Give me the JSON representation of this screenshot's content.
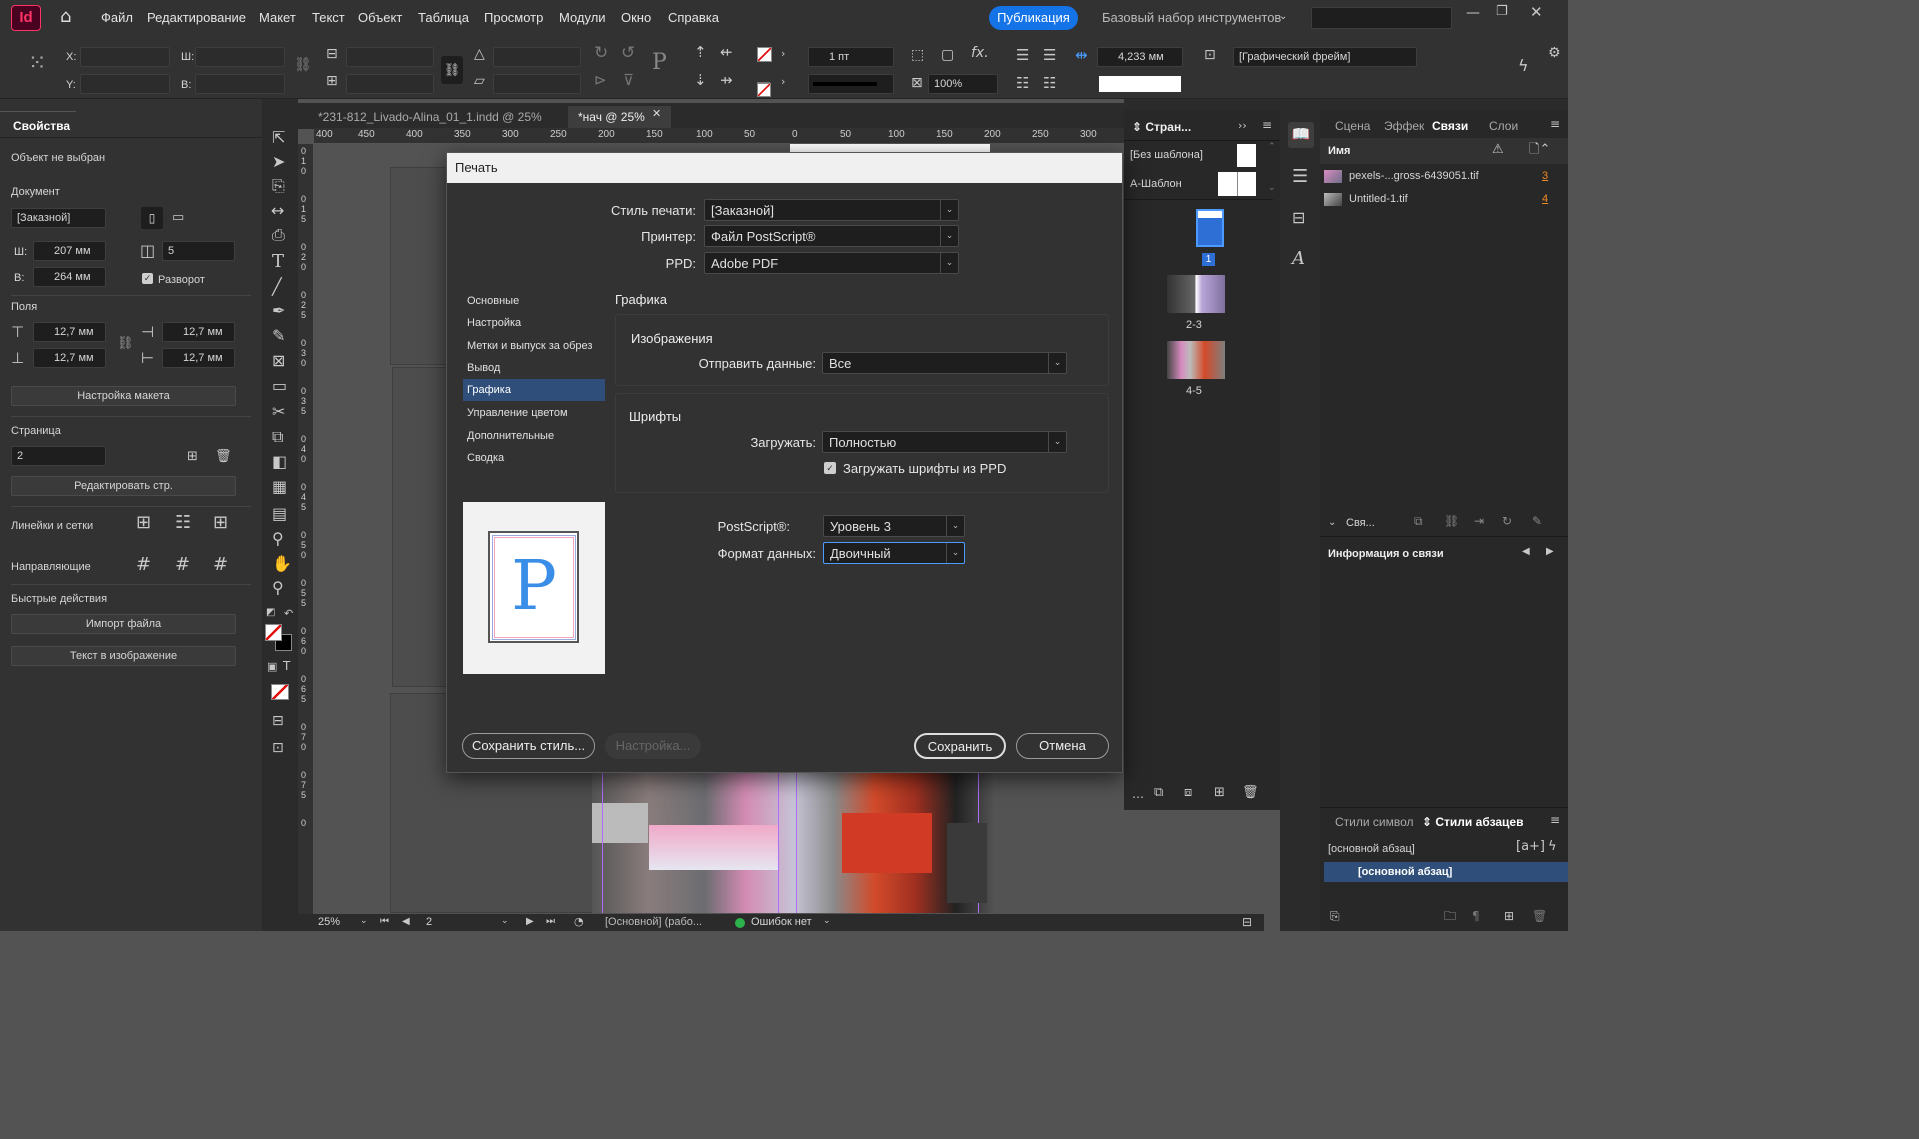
{
  "menubar": {
    "app_logo": "Id",
    "items": [
      "Файл",
      "Редактирование",
      "Макет",
      "Текст",
      "Объект",
      "Таблица",
      "Просмотр",
      "Модули",
      "Окно",
      "Справка"
    ],
    "publish": "Публикация",
    "workspace": "Базовый набор инструментов"
  },
  "control": {
    "x_label": "X:",
    "y_label": "Y:",
    "w_label": "Ш:",
    "h_label": "В:",
    "stroke_weight": "1 пт",
    "zoom_pct": "100%",
    "size_mm": "4,233 мм",
    "frame_style": "[Графический фрейм]"
  },
  "tabs": [
    "*231-812_Livado-Alina_01_1.indd @ 25%",
    "*нач @ 25%"
  ],
  "ruler": {
    "marks": [
      "400",
      "450",
      "400",
      "350",
      "300",
      "250",
      "200",
      "150",
      "100",
      "50",
      "0",
      "50",
      "100",
      "150",
      "200",
      "250",
      "300"
    ],
    "v_marks": [
      "0",
      "1",
      "0",
      "0",
      "1",
      "5",
      "0",
      "2",
      "0",
      "0",
      "2",
      "5",
      "0",
      "3",
      "0",
      "0",
      "3",
      "5",
      "0",
      "4",
      "0",
      "0",
      "4",
      "5",
      "0",
      "5",
      "0",
      "0",
      "5",
      "5",
      "0",
      "6",
      "0",
      "0",
      "6",
      "5",
      "0",
      "7",
      "0",
      "0",
      "7",
      "5",
      "0"
    ]
  },
  "properties": {
    "tab": "Свойства",
    "no_selection": "Объект не выбран",
    "document": "Документ",
    "preset": "[Заказной]",
    "width_label": "Ш:",
    "width": "207 мм",
    "height_label": "В:",
    "height": "264 мм",
    "pages": "5",
    "facing": "Разворот",
    "margins": "Поля",
    "m_top": "12,7 мм",
    "m_bottom": "12,7 мм",
    "m_left": "12,7 мм",
    "m_right": "12,7 мм",
    "layout_btn": "Настройка макета",
    "page": "Страница",
    "page_num": "2",
    "edit_page_btn": "Редактировать стр.",
    "rulers_grids": "Линейки и сетки",
    "guides": "Направляющие",
    "quick_actions": "Быстрые действия",
    "import_btn": "Импорт файла",
    "text_to_image_btn": "Текст в изображение"
  },
  "pages_panel": {
    "title": "Стран...",
    "none_master": "[Без шаблона]",
    "a_master": "А-Шаблон",
    "p1": "1",
    "p23": "2-3",
    "p45": "4-5"
  },
  "links_panel": {
    "tabs": [
      "Сцена",
      "Эффек",
      "Связи",
      "Слои"
    ],
    "name_col": "Имя",
    "items": [
      {
        "name": "pexels-...gross-6439051.tif",
        "page": "3"
      },
      {
        "name": "Untitled-1.tif",
        "page": "4"
      }
    ],
    "link_short": "Свя...",
    "link_info": "Информация о связи"
  },
  "styles_panel": {
    "tabs": [
      "Стили символ",
      "Стили абзацев"
    ],
    "current": "[основной абзац]",
    "item": "[основной абзац]"
  },
  "statusbar": {
    "zoom": "25%",
    "page": "2",
    "style": "[Основной] (рабо...",
    "errors": "Ошибок нет"
  },
  "print_dialog": {
    "title": "Печать",
    "style_label": "Стиль печати:",
    "style_value": "[Заказной]",
    "printer_label": "Принтер:",
    "printer_value": "Файл PostScript®",
    "ppd_label": "PPD:",
    "ppd_value": "Adobe PDF",
    "nav": [
      "Основные",
      "Настройка",
      "Метки и выпуск за обрез",
      "Вывод",
      "Графика",
      "Управление цветом",
      "Дополнительные",
      "Сводка"
    ],
    "section": "Графика",
    "images_group": "Изображения",
    "send_label": "Отправить данные:",
    "send_value": "Все",
    "fonts_group": "Шрифты",
    "download_label": "Загружать:",
    "download_value": "Полностью",
    "ppd_fonts": "Загружать шрифты из PPD",
    "postscript_label": "PostScript®:",
    "postscript_value": "Уровень 3",
    "format_label": "Формат данных:",
    "format_value": "Двоичный",
    "preview_letter": "P",
    "save_style_btn": "Сохранить стиль...",
    "setup_btn": "Настройка...",
    "save_btn": "Сохранить",
    "cancel_btn": "Отмена"
  }
}
